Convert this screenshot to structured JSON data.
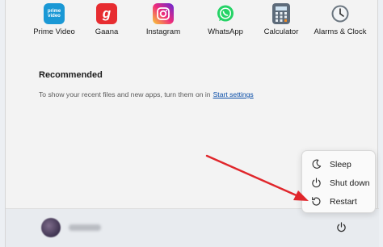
{
  "apps": [
    {
      "name": "prime-video",
      "label": "Prime Video",
      "icon": "prime-video-icon",
      "color": "#1a98d5"
    },
    {
      "name": "gaana",
      "label": "Gaana",
      "icon": "gaana-icon",
      "color": "#e72c30"
    },
    {
      "name": "instagram",
      "label": "Instagram",
      "icon": "instagram-icon",
      "color": "#d6249f"
    },
    {
      "name": "whatsapp",
      "label": "WhatsApp",
      "icon": "whatsapp-icon",
      "color": "#25d366"
    },
    {
      "name": "calculator",
      "label": "Calculator",
      "icon": "calculator-icon",
      "color": "#5d6b7a"
    },
    {
      "name": "alarms-clock",
      "label": "Alarms & Clock",
      "icon": "clock-icon",
      "color": "#6b7680"
    }
  ],
  "prime_logo_text": "prime video",
  "gaana_logo_text": "g",
  "recommended": {
    "title": "Recommended",
    "description": "To show your recent files and new apps, turn them on in",
    "link": "Start settings"
  },
  "power_menu": {
    "sleep": "Sleep",
    "shutdown": "Shut down",
    "restart": "Restart"
  },
  "colors": {
    "arrow": "#e0262b",
    "link": "#0a4ea8"
  }
}
